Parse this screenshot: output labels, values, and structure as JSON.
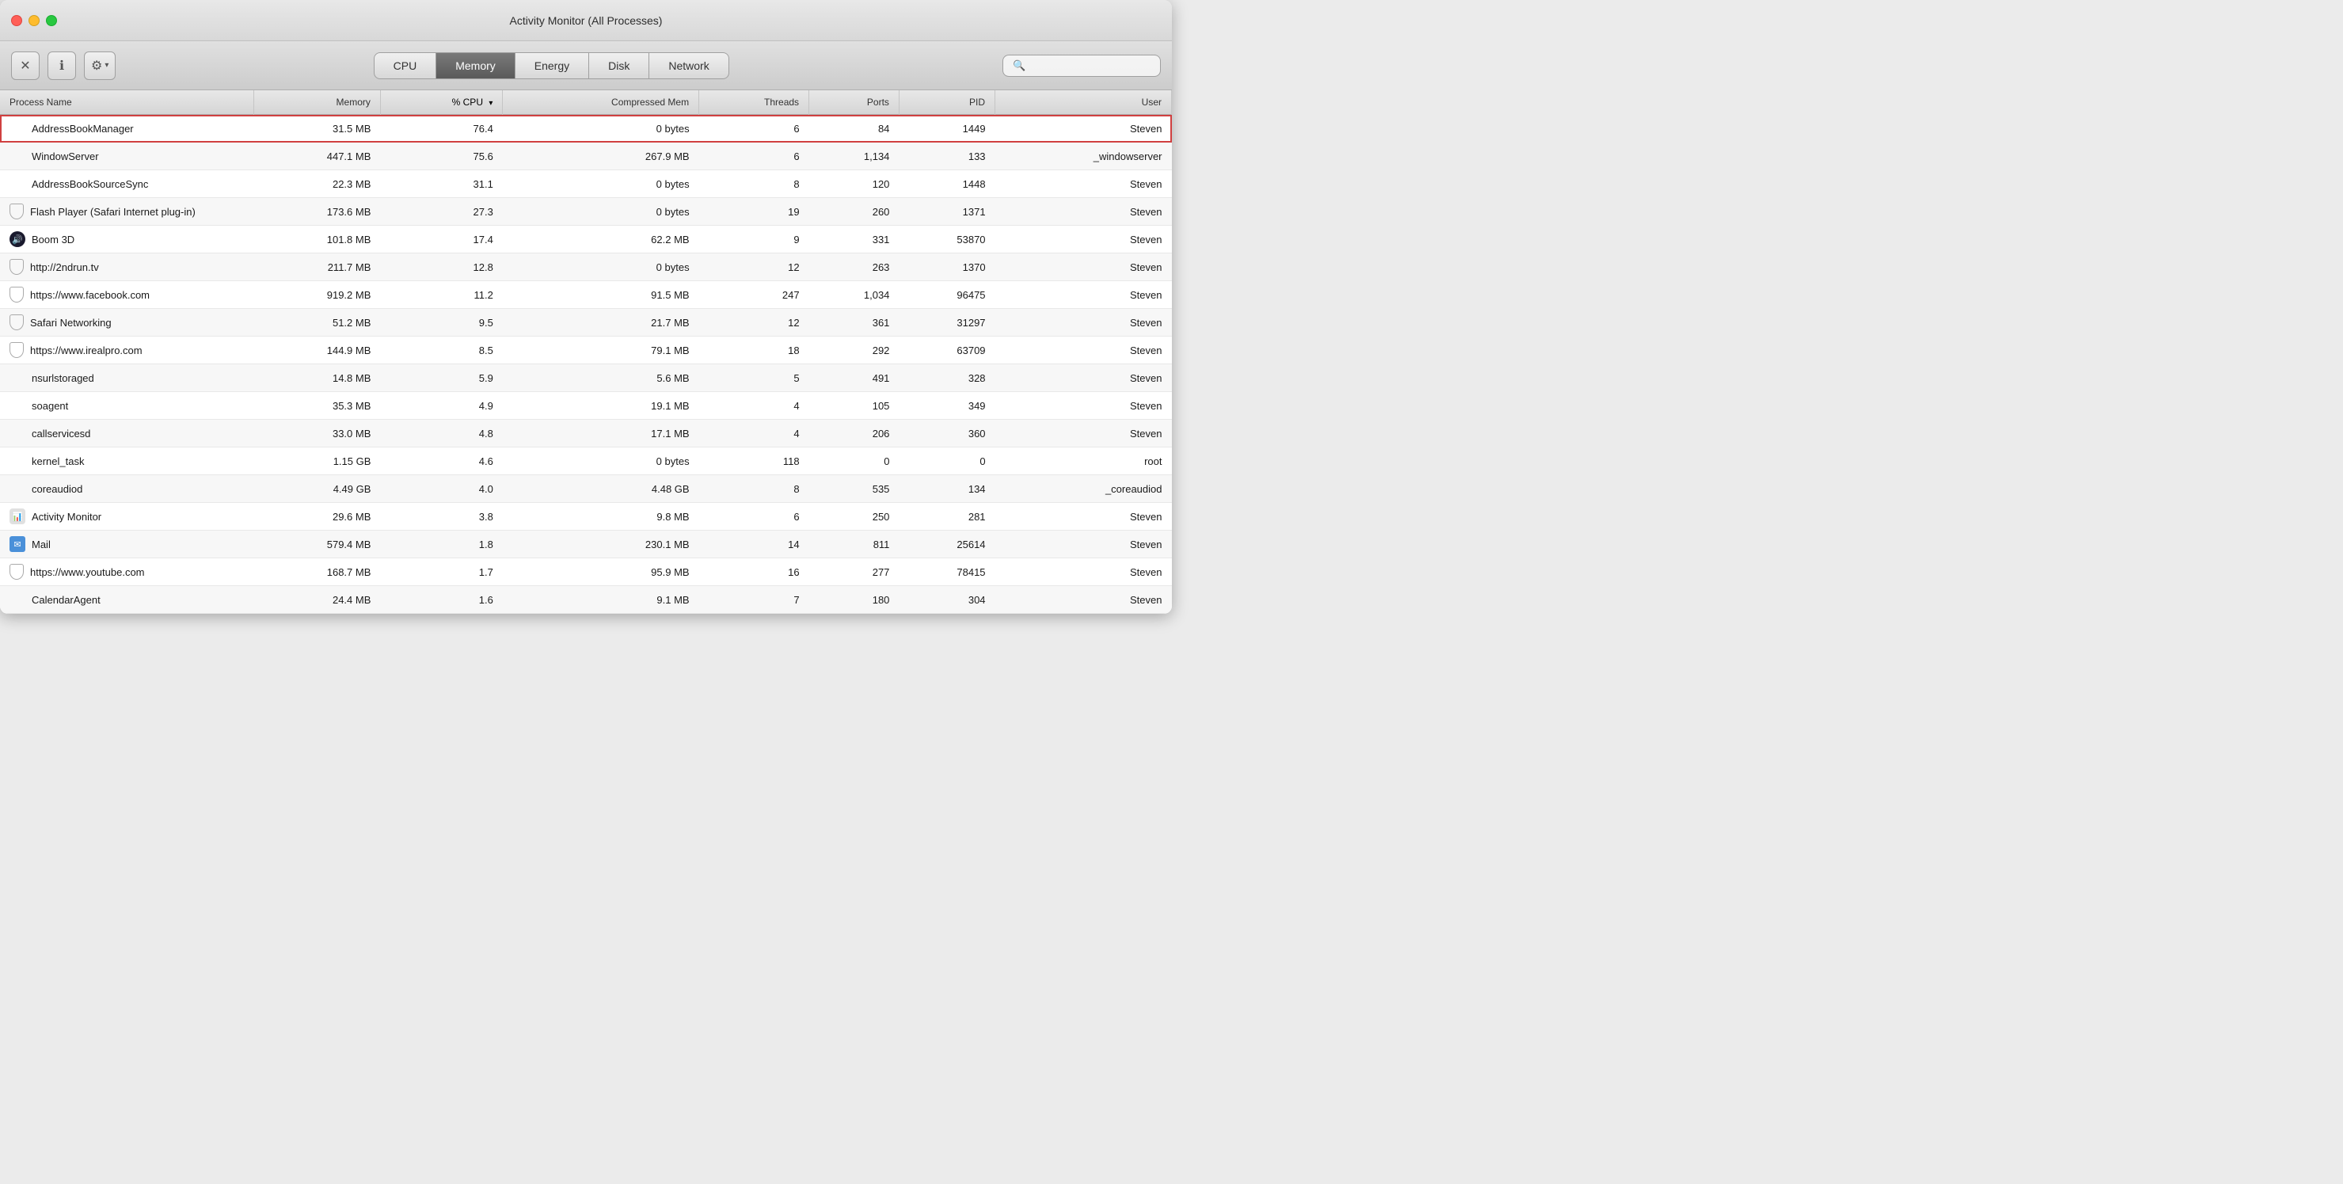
{
  "window": {
    "title": "Activity Monitor (All Processes)"
  },
  "toolbar": {
    "close_label": "✕",
    "info_label": "ℹ",
    "gear_label": "⚙",
    "chevron_label": "▾",
    "search_placeholder": "Search"
  },
  "tabs": [
    {
      "id": "cpu",
      "label": "CPU",
      "active": false
    },
    {
      "id": "memory",
      "label": "Memory",
      "active": true
    },
    {
      "id": "energy",
      "label": "Energy",
      "active": false
    },
    {
      "id": "disk",
      "label": "Disk",
      "active": false
    },
    {
      "id": "network",
      "label": "Network",
      "active": false
    }
  ],
  "columns": [
    {
      "id": "process-name",
      "label": "Process Name",
      "align": "left"
    },
    {
      "id": "memory",
      "label": "Memory",
      "align": "right"
    },
    {
      "id": "cpu",
      "label": "% CPU",
      "align": "right",
      "sorted": true,
      "dir": "desc"
    },
    {
      "id": "compressed-mem",
      "label": "Compressed Mem",
      "align": "right"
    },
    {
      "id": "threads",
      "label": "Threads",
      "align": "right"
    },
    {
      "id": "ports",
      "label": "Ports",
      "align": "right"
    },
    {
      "id": "pid",
      "label": "PID",
      "align": "right"
    },
    {
      "id": "user",
      "label": "User",
      "align": "right"
    }
  ],
  "processes": [
    {
      "name": "AddressBookManager",
      "memory": "31.5 MB",
      "cpu": "76.4",
      "compressed": "0 bytes",
      "threads": "6",
      "ports": "84",
      "pid": "1449",
      "user": "Steven",
      "icon": "none",
      "selected": true
    },
    {
      "name": "WindowServer",
      "memory": "447.1 MB",
      "cpu": "75.6",
      "compressed": "267.9 MB",
      "threads": "6",
      "ports": "1,134",
      "pid": "133",
      "user": "_windowserver",
      "icon": "none",
      "selected": false
    },
    {
      "name": "AddressBookSourceSync",
      "memory": "22.3 MB",
      "cpu": "31.1",
      "compressed": "0 bytes",
      "threads": "8",
      "ports": "120",
      "pid": "1448",
      "user": "Steven",
      "icon": "none",
      "selected": false
    },
    {
      "name": "Flash Player (Safari Internet plug-in)",
      "memory": "173.6 MB",
      "cpu": "27.3",
      "compressed": "0 bytes",
      "threads": "19",
      "ports": "260",
      "pid": "1371",
      "user": "Steven",
      "icon": "shield",
      "selected": false
    },
    {
      "name": "Boom 3D",
      "memory": "101.8 MB",
      "cpu": "17.4",
      "compressed": "62.2 MB",
      "threads": "9",
      "ports": "331",
      "pid": "53870",
      "user": "Steven",
      "icon": "boom",
      "selected": false
    },
    {
      "name": "http://2ndrun.tv",
      "memory": "211.7 MB",
      "cpu": "12.8",
      "compressed": "0 bytes",
      "threads": "12",
      "ports": "263",
      "pid": "1370",
      "user": "Steven",
      "icon": "shield",
      "selected": false
    },
    {
      "name": "https://www.facebook.com",
      "memory": "919.2 MB",
      "cpu": "11.2",
      "compressed": "91.5 MB",
      "threads": "247",
      "ports": "1,034",
      "pid": "96475",
      "user": "Steven",
      "icon": "shield",
      "selected": false
    },
    {
      "name": "Safari Networking",
      "memory": "51.2 MB",
      "cpu": "9.5",
      "compressed": "21.7 MB",
      "threads": "12",
      "ports": "361",
      "pid": "31297",
      "user": "Steven",
      "icon": "shield",
      "selected": false
    },
    {
      "name": "https://www.irealpro.com",
      "memory": "144.9 MB",
      "cpu": "8.5",
      "compressed": "79.1 MB",
      "threads": "18",
      "ports": "292",
      "pid": "63709",
      "user": "Steven",
      "icon": "shield",
      "selected": false
    },
    {
      "name": "nsurlstoraged",
      "memory": "14.8 MB",
      "cpu": "5.9",
      "compressed": "5.6 MB",
      "threads": "5",
      "ports": "491",
      "pid": "328",
      "user": "Steven",
      "icon": "none",
      "selected": false
    },
    {
      "name": "soagent",
      "memory": "35.3 MB",
      "cpu": "4.9",
      "compressed": "19.1 MB",
      "threads": "4",
      "ports": "105",
      "pid": "349",
      "user": "Steven",
      "icon": "none",
      "selected": false
    },
    {
      "name": "callservicesd",
      "memory": "33.0 MB",
      "cpu": "4.8",
      "compressed": "17.1 MB",
      "threads": "4",
      "ports": "206",
      "pid": "360",
      "user": "Steven",
      "icon": "none",
      "selected": false
    },
    {
      "name": "kernel_task",
      "memory": "1.15 GB",
      "cpu": "4.6",
      "compressed": "0 bytes",
      "threads": "118",
      "ports": "0",
      "pid": "0",
      "user": "root",
      "icon": "none",
      "selected": false
    },
    {
      "name": "coreaudiod",
      "memory": "4.49 GB",
      "cpu": "4.0",
      "compressed": "4.48 GB",
      "threads": "8",
      "ports": "535",
      "pid": "134",
      "user": "_coreaudiod",
      "icon": "none",
      "selected": false
    },
    {
      "name": "Activity Monitor",
      "memory": "29.6 MB",
      "cpu": "3.8",
      "compressed": "9.8 MB",
      "threads": "6",
      "ports": "250",
      "pid": "281",
      "user": "Steven",
      "icon": "activity",
      "selected": false
    },
    {
      "name": "Mail",
      "memory": "579.4 MB",
      "cpu": "1.8",
      "compressed": "230.1 MB",
      "threads": "14",
      "ports": "811",
      "pid": "25614",
      "user": "Steven",
      "icon": "mail",
      "selected": false
    },
    {
      "name": "https://www.youtube.com",
      "memory": "168.7 MB",
      "cpu": "1.7",
      "compressed": "95.9 MB",
      "threads": "16",
      "ports": "277",
      "pid": "78415",
      "user": "Steven",
      "icon": "shield",
      "selected": false
    },
    {
      "name": "CalendarAgent",
      "memory": "24.4 MB",
      "cpu": "1.6",
      "compressed": "9.1 MB",
      "threads": "7",
      "ports": "180",
      "pid": "304",
      "user": "Steven",
      "icon": "none",
      "selected": false
    }
  ]
}
